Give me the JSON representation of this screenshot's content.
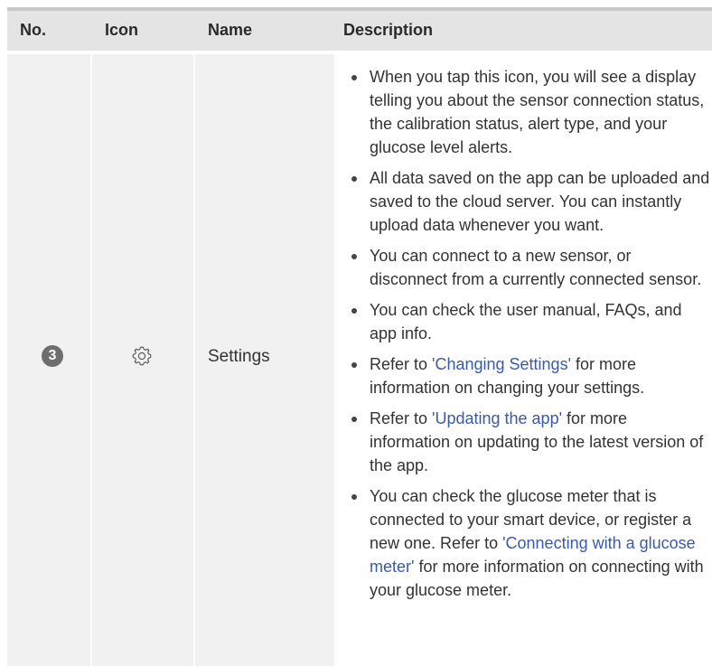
{
  "header": {
    "no": "No.",
    "icon": "Icon",
    "name": "Name",
    "description": "Description"
  },
  "row": {
    "number": "3",
    "icon": "gear-icon",
    "name": "Settings",
    "items": [
      {
        "text": "When you tap this icon, you will see a display telling you about the sensor connection status, the calibration status, alert type, and your glucose level alerts."
      },
      {
        "text": "All data saved on the app can be uploaded and saved to the cloud server. You can instantly upload data whenever you want."
      },
      {
        "text": "You can connect to a new sensor, or disconnect from a currently connected sensor."
      },
      {
        "text": "You can check the user manual, FAQs, and app info."
      },
      {
        "pre": "Refer to ",
        "link": "'Changing Settings'",
        "post": " for more information on changing your settings."
      },
      {
        "pre": "Refer to ",
        "link": "'Updating the app'",
        "post": " for more information on updating to the latest version of the app."
      },
      {
        "pre": "You can check the glucose meter that is connected to your smart device, or register a new one. Refer to ",
        "link": "'Connecting with a glucose meter'",
        "post": " for more information on connecting with your glucose meter."
      }
    ]
  },
  "colors": {
    "header_bg": "#e4e4e4",
    "row_bg": "#f1f1f1",
    "link": "#3a5aa8",
    "badge": "#6e6e6e"
  }
}
